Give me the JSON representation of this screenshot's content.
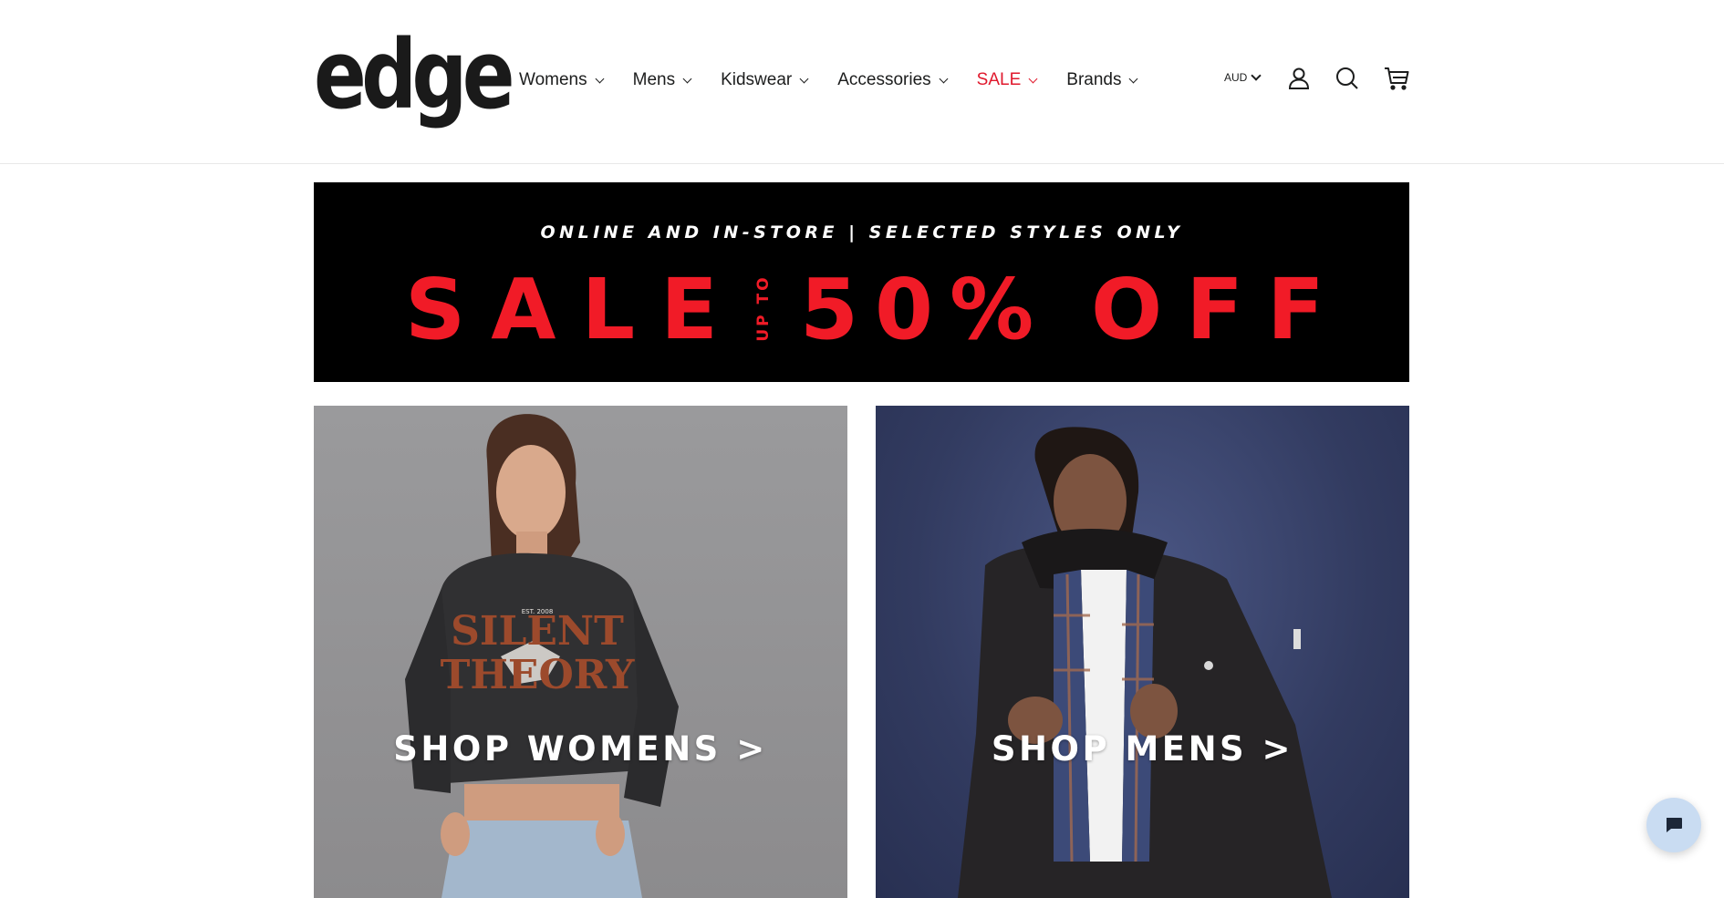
{
  "header": {
    "logo_text": "edge",
    "nav": [
      {
        "label": "Womens"
      },
      {
        "label": "Mens"
      },
      {
        "label": "Kidswear"
      },
      {
        "label": "Accessories"
      },
      {
        "label": "SALE"
      },
      {
        "label": "Brands"
      }
    ],
    "currency": "AUD",
    "icons": [
      "account-icon",
      "search-icon",
      "cart-icon"
    ]
  },
  "banner": {
    "subtitle": "ONLINE AND IN-STORE | SELECTED STYLES ONLY",
    "sale_word": "SALE",
    "up_to": "UP TO",
    "percent": "50%",
    "off_word": "OFF"
  },
  "tiles": {
    "women": {
      "label": "SHOP WOMENS >",
      "shirt_text_1": "EST. 2008",
      "shirt_text_2": "SILENT",
      "shirt_text_3": "THEORY"
    },
    "men": {
      "label": "SHOP MENS >"
    }
  },
  "colors": {
    "accent_sale": "#e0192d",
    "banner_red": "#f11b27",
    "chat_bg": "#c9dcf2"
  }
}
